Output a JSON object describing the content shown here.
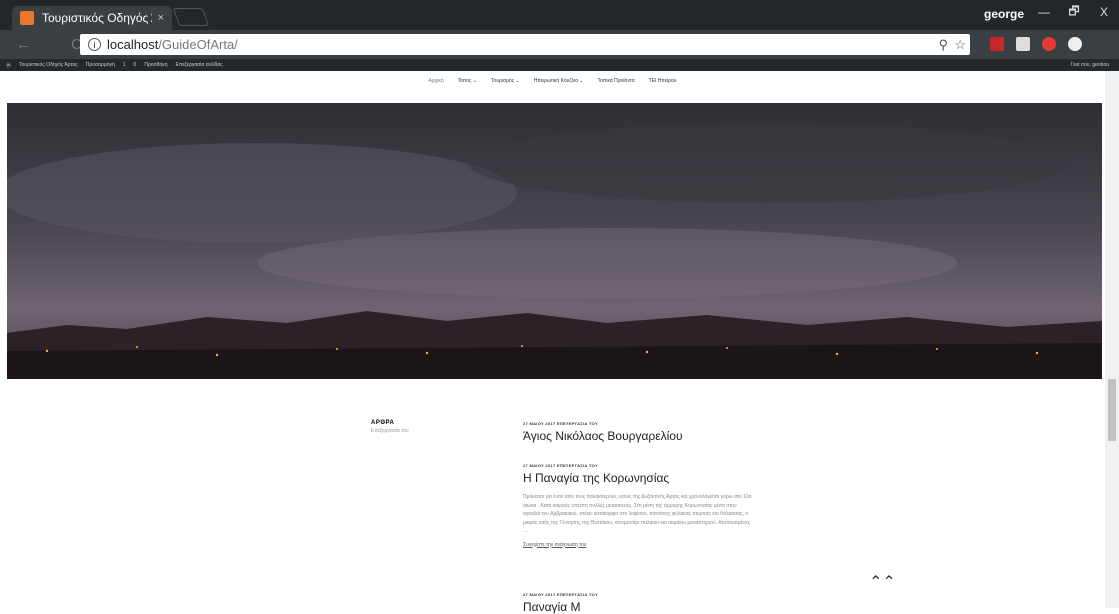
{
  "browser": {
    "tab_title": "Τουριστικός Οδηγός Άρ",
    "tab_close": "×",
    "user": "george",
    "window_buttons": [
      "—",
      "🗗",
      "X"
    ],
    "url_host": "localhost",
    "url_path": "/GuideOfArta/",
    "nav": {
      "back": "←",
      "reload": "C"
    }
  },
  "adminbar": {
    "items": [
      "Τουριστικός Οδηγός Άρτας",
      "Προσαρμογή",
      "1",
      "0",
      "Προσθήκη",
      "Επεξεργασία σελίδας"
    ],
    "greeting": "Γεια σου, geobou"
  },
  "menu": [
    "Αρχική",
    "Τόπος ⌄",
    "Τουρισμός ⌄",
    "Ηπειρωτική Κουζίνα ⌄",
    "Τοπικά Προϊόντα",
    "ΤΕΙ Ηπείρου"
  ],
  "sidebar": {
    "heading": "ΑΡΘΡΑ",
    "subtitle": "Επεξεργασία του"
  },
  "posts": [
    {
      "meta": "27 ΜΑΙΟΥ 2017   ΕΠΕΞΕΡΓΑΣΙΑ ΤΟΥ",
      "title": "Άγιος Νικόλαος Βουργαρελίου"
    },
    {
      "meta": "27 ΜΑΙΟΥ 2017   ΕΠΕΞΕΡΓΑΣΙΑ ΤΟΥ",
      "title": "Η Παναγία της Κορωνησίας",
      "excerpt": "Πρόκειται για έναν από τους παλαιότερους ναούς της βυζαντινής Άρτας και χρονολογείται γύρω στο 10ο αιώνα . Κατά καιρούς υπέστη πολλές μετασκευές. Στη μέση της άμμορης Κορωνησίας μέσα στην αγκαλιά του Αμβρακικού, στέκει κατάκορφα στο λοφίσκο, παντάνης φύλακας ατερπάς και θάλασσας, ο μικρός ναός της Γέννησης της Θεοτόκου, απομεινάρι παλαιού και ακμαίου μοναστηριού. Απόσωσμένες …",
      "readmore": "Συνεχίστε την ανάγνωση του"
    },
    {
      "meta": "27 ΜΑΙΟΥ 2017   ΕΠΕΞΕΡΓΑΣΙΑ ΤΟΥ",
      "title": "Παναγία Μ"
    }
  ],
  "totop": "⌃⌃",
  "colors": {
    "titlebar": "#23272b",
    "toolbar": "#3a3f44",
    "adminbar": "#23282d",
    "favicon": "#e9772c"
  }
}
